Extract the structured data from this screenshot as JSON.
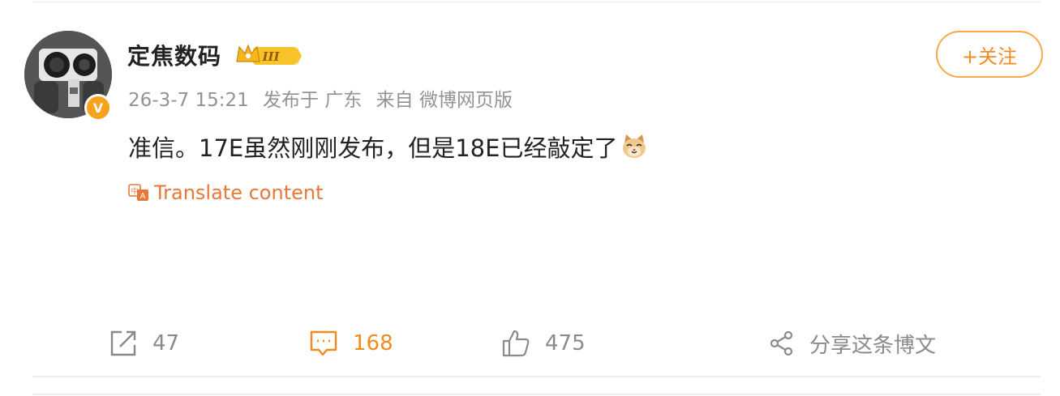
{
  "post": {
    "username": "定焦数码",
    "level_label": "III",
    "timestamp": "26-3-7 15:21",
    "location": "发布于 广东",
    "source": "来自 微博网页版",
    "content": "准信。17E虽然刚刚发布，但是18E已经敲定了",
    "emoji": "cat-emoji",
    "verified_mark": "V"
  },
  "follow_button": {
    "label": "+关注"
  },
  "translate": {
    "label": "Translate content",
    "icon": "translate-icon"
  },
  "actions": {
    "repost": {
      "icon": "repost-icon",
      "count": "47"
    },
    "comment": {
      "icon": "comment-icon",
      "count": "168"
    },
    "like": {
      "icon": "thumbs-up-icon",
      "count": "475"
    },
    "share": {
      "icon": "share-icon",
      "label": "分享这条博文"
    }
  },
  "colors": {
    "accent": "#f08c1f",
    "translate": "#e8773a",
    "muted": "#939393",
    "text": "#222222"
  }
}
